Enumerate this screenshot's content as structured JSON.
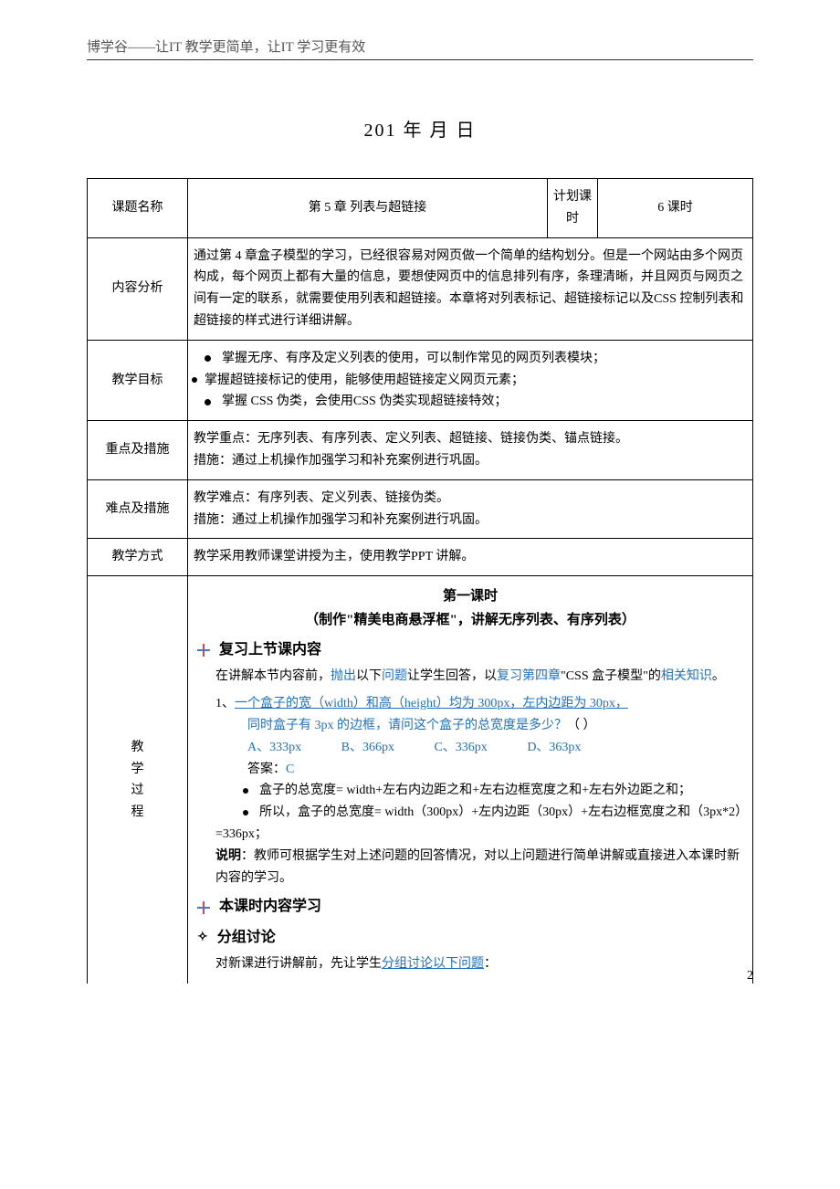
{
  "header": "博学谷——让IT 教学更简单，让IT 学习更有效",
  "date": "201   年   月   日",
  "labels": {
    "topic": "课题名称",
    "plan": "计划课时",
    "analysis": "内容分析",
    "goals": "教学目标",
    "key": "重点及措施",
    "diff": "难点及措施",
    "mode": "教学方式",
    "process": "教学过程"
  },
  "topic_name": "第 5 章 列表与超链接",
  "plan_hours": "6 课时",
  "analysis_text": "通过第 4 章盒子模型的学习，已经很容易对网页做一个简单的结构划分。但是一个网站由多个网页构成，每个网页上都有大量的信息，要想使网页中的信息排列有序，条理清晰，并且网页与网页之间有一定的联系，就需要使用列表和超链接。本章将对列表标记、超链接标记以及CSS 控制列表和超链接的样式进行详细讲解。",
  "goals": {
    "g1": "掌握无序、有序及定义列表的使用，可以制作常见的网页列表模块；",
    "g2": "掌握超链接标记的使用，能够使用超链接定义网页元素；",
    "g3": "掌握 CSS 伪类，会使用CSS 伪类实现超链接特效；"
  },
  "key_text1": "教学重点：无序列表、有序列表、定义列表、超链接、链接伪类、锚点链接。",
  "key_text2": "措施：通过上机操作加强学习和补充案例进行巩固。",
  "diff_text1": "教学难点：有序列表、定义列表、链接伪类。",
  "diff_text2": "措施：通过上机操作加强学习和补充案例进行巩固。",
  "mode_text": "教学采用教师课堂讲授为主，使用教学PPT 讲解。",
  "process": {
    "lesson_title": "第一课时",
    "lesson_sub": "（制作\"精美电商悬浮框\"，讲解无序列表、有序列表）",
    "review_head": "复习上节课内容",
    "review_p1_a": "在讲解本节内容前，",
    "review_p1_b": "抛出",
    "review_p1_c": "以下",
    "review_p1_d": "问题",
    "review_p1_e": "让学生回答，以",
    "review_p1_f": "复习第四章",
    "review_p1_g": "\"CSS 盒子模型\"的",
    "review_p1_h": "相关知识",
    "review_p1_i": "。",
    "q1_a": "1、",
    "q1_b": "一个盒子的宽（width）和高（height）均为 300px，左内边距为 30px，",
    "q1_c": "同时盒子有 3px 的边框，请问这个盒子的总宽度是多少？",
    "q1_d": "（  ）",
    "opts": {
      "a": "A、333px",
      "b": "B、366px",
      "c": "C、336px",
      "d": "D、363px"
    },
    "ans_label": "答案：",
    "ans_val": "C",
    "exp1": "盒子的总宽度= width+左右内边距之和+左右边框宽度之和+左右外边距之和；",
    "exp2": "所以，盒子的总宽度= width（300px）+左内边距（30px）+左右边框宽度之和（3px*2）=336px；",
    "note_label": "说明",
    "note_text": "：教师可根据学生对上述问题的回答情况，对以上问题进行简单讲解或直接进入本课时新内容的学习。",
    "learn_head": "本课时内容学习",
    "discuss_head": "分组讨论",
    "discuss_p_a": "对新课进行讲解前，先让学生",
    "discuss_p_b": "分组讨论以下问题",
    "discuss_p_c": "："
  },
  "page_num": "2"
}
